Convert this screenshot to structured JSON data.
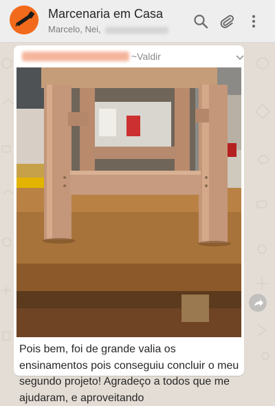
{
  "header": {
    "title": "Marcenaria em Casa",
    "members": "Marcelo, Nei,",
    "search_icon": "search-icon",
    "attach_icon": "paperclip-icon",
    "menu_icon": "more-vert-icon"
  },
  "message": {
    "sender_name": "~Valdir",
    "text": "Pois bem, foi de grande valia os ensinamentos pois conseguiu concluir o meu segundo projeto! Agradeço a todos que me ajudaram, e aproveitando",
    "image_alt": "Banquinho de madeira sobre a mesa"
  },
  "colors": {
    "avatar": "#f26a1b",
    "header_bg": "#eeeeee",
    "chat_bg": "#e4ddd5",
    "bubble_bg": "#ffffff"
  }
}
